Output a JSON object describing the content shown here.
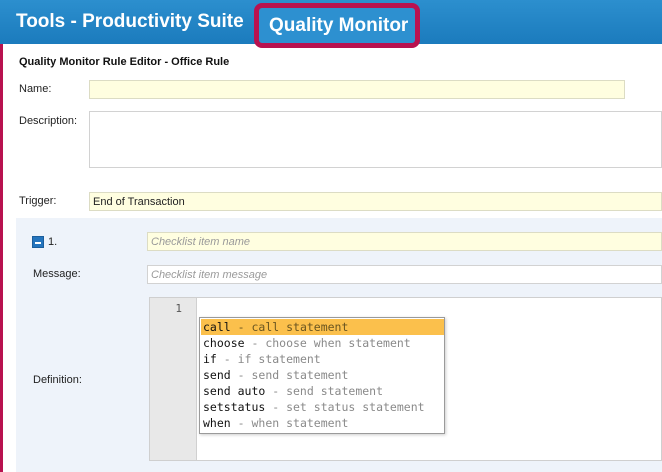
{
  "header": {
    "app_title": "Tools - Productivity Suite",
    "module_title": "Quality Monitor"
  },
  "editor": {
    "title": "Quality Monitor Rule Editor - Office Rule",
    "name_label": "Name:",
    "name_value": "",
    "description_label": "Description:",
    "description_value": "",
    "trigger_label": "Trigger:",
    "trigger_value": "End of Transaction"
  },
  "checklist_item": {
    "number": "1.",
    "name_placeholder": "Checklist item name",
    "message_label": "Message:",
    "message_placeholder": "Checklist item message",
    "definition_label": "Definition:",
    "line_number": "1"
  },
  "autocomplete": {
    "items": [
      {
        "keyword": "call",
        "description": " - call statement"
      },
      {
        "keyword": "choose",
        "description": " - choose when statement"
      },
      {
        "keyword": "if",
        "description": " - if statement"
      },
      {
        "keyword": "send",
        "description": " - send statement"
      },
      {
        "keyword": "send auto",
        "description": " - send statement"
      },
      {
        "keyword": "setstatus",
        "description": " - set status statement"
      },
      {
        "keyword": "when",
        "description": " - when statement"
      }
    ],
    "selected_index": 0
  },
  "colors": {
    "header": "#1b7bbd",
    "highlight_border": "#b8124f",
    "field_yellow": "#fffee0",
    "selected_item": "#fbc04c"
  }
}
